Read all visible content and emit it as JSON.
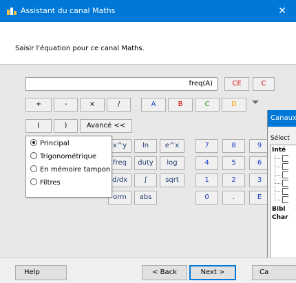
{
  "window": {
    "title": "Assistant du canal Maths",
    "close_label": "✕"
  },
  "header": {
    "prompt": "Saisir l'équation pour ce canal Maths."
  },
  "equation": {
    "value": "freq(A)"
  },
  "row1": {
    "ce": "CE",
    "c": "C"
  },
  "row2": {
    "plus": "+",
    "minus": "-",
    "times": "×",
    "divide": "/",
    "a": "A",
    "b": "B",
    "c": "C",
    "d": "D"
  },
  "row3": {
    "lparen": "(",
    "rparen": ")",
    "advanced": "Avancé <<"
  },
  "functions": {
    "xy": "x^y",
    "ln": "ln",
    "ex": "e^x",
    "freq": "freq",
    "duty": "duty",
    "log": "log",
    "ddx": "d/dx",
    "integral": "∫",
    "sqrt": "sqrt",
    "norm": "orm",
    "abs": "abs"
  },
  "keypad": {
    "k7": "7",
    "k8": "8",
    "k9": "9",
    "k4": "4",
    "k5": "5",
    "k6": "6",
    "k1": "1",
    "k2": "2",
    "k3": "3",
    "k0": "0",
    "dot": ".",
    "e": "E"
  },
  "popup": {
    "options": [
      "Principal",
      "Trigonométrique",
      "En mémoire tampon",
      "Filtres"
    ],
    "selected": "Principal"
  },
  "side_window": {
    "title": "Canaux",
    "label": "Sélect",
    "tree_groups": [
      "Inté",
      "Bibl",
      "Char"
    ],
    "item_box": "["
  },
  "footer": {
    "help": "Help",
    "back": "< Back",
    "next": "Next >",
    "cancel": "Ca"
  },
  "colors": {
    "accent": "#0078d7",
    "red": "#d40000",
    "green": "#2a8f2a",
    "orange": "#ff9a00",
    "blue": "#1a3ec8"
  }
}
